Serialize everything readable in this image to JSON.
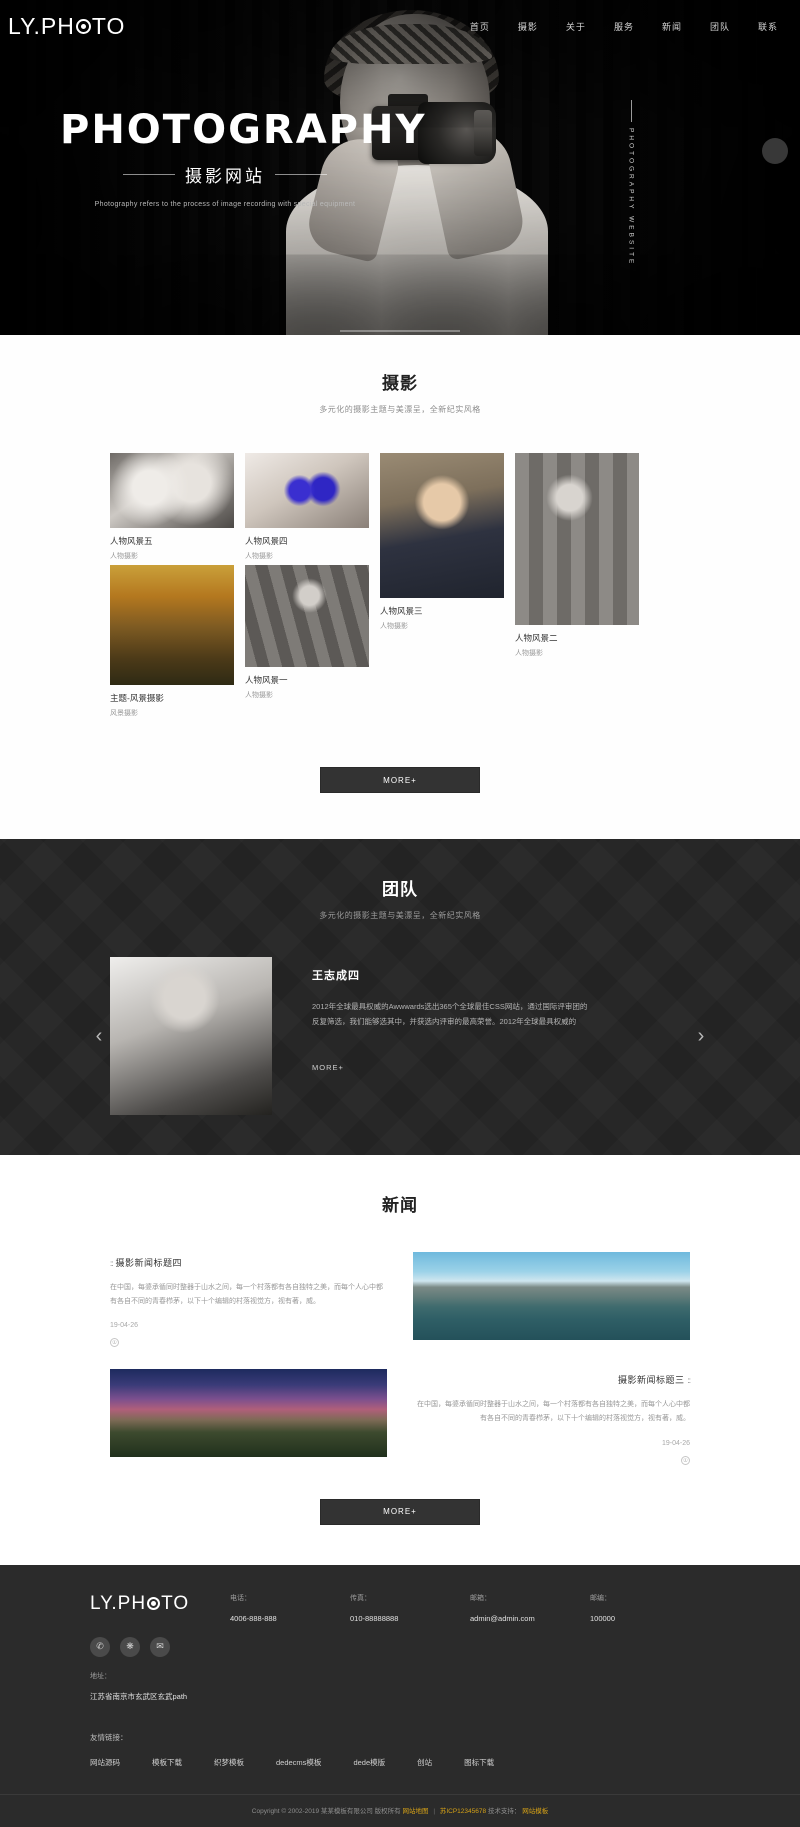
{
  "brand": {
    "name": "LY.PHOTO",
    "pre": "LY.PH",
    "post": "TO"
  },
  "nav": {
    "items": [
      {
        "label": "首页"
      },
      {
        "label": "摄影"
      },
      {
        "label": "关于"
      },
      {
        "label": "服务"
      },
      {
        "label": "新闻"
      },
      {
        "label": "团队"
      },
      {
        "label": "联系"
      }
    ]
  },
  "hero": {
    "title": "PHOTOGRAPHY",
    "subtitle": "摄影网站",
    "description": "Photography refers to the process of image recording with special equipment",
    "vertical_text": "PHOTOGRAPHY WEBSITE"
  },
  "photography": {
    "title": "摄影",
    "subtitle": "多元化的摄影主题与美漂呈，全新纪实风格",
    "more_label": "MORE+",
    "items": [
      {
        "title": "人物风景五",
        "category": "人物摄影"
      },
      {
        "title": "人物风景四",
        "category": "人物摄影"
      },
      {
        "title": "人物风景三",
        "category": "人物摄影"
      },
      {
        "title": "人物风景二",
        "category": "人物摄影"
      },
      {
        "title": "主题-风景摄影",
        "category": "风景摄影"
      },
      {
        "title": "人物风景一",
        "category": "人物摄影"
      }
    ]
  },
  "team": {
    "title": "团队",
    "subtitle": "多元化的摄影主题与美漂呈，全新纪实风格",
    "member_name": "王志成四",
    "member_desc": "2012年全球最具权威的Awwwards选出365个全球最佳CSS网站，通过国际评审团的反复筛选，我们能够选其中，并获选内评审的最高荣誉。2012年全球最具权威的",
    "more_label": "MORE+",
    "prev_icon": "‹",
    "next_icon": "›"
  },
  "news": {
    "title": "新闻",
    "more_label": "MORE+",
    "items": [
      {
        "dots": "::",
        "title": "摄影新闻标题四",
        "body": "在中国，每婆承循同时整器于山水之间，每一个村落都有各自独特之美，而每个人心中都有各自不同的青春栉茅，以下十个编辑的村落视觉方，视有著，威。",
        "date": "19-04-26",
        "circle": "①"
      },
      {
        "dots": "::",
        "title": "摄影新闻标题三",
        "body": "在中国，每婆承循同时整器于山水之间，每一个村落都有各自独特之美，而每个人心中都有各自不同的青春栉茅，以下十个编辑的村落视觉方，视有著，威。",
        "date": "19-04-26",
        "circle": "①"
      }
    ]
  },
  "footer": {
    "contacts": [
      {
        "label": "电话：",
        "value": "4006-888-888"
      },
      {
        "label": "传真：",
        "value": "010-88888888"
      },
      {
        "label": "邮箱：",
        "value": "admin@admin.com"
      },
      {
        "label": "邮编：",
        "value": "100000"
      }
    ],
    "address": {
      "label": "地址：",
      "value": "江苏省南京市玄武区玄武path"
    },
    "links": {
      "label": "友情链接：",
      "items": [
        "网站源码",
        "模板下载",
        "织梦模板",
        "dedecms模板",
        "dede模版",
        "创站",
        "图标下载"
      ]
    },
    "socials": [
      "qq-icon",
      "weibo-icon",
      "wechat-icon"
    ],
    "copyright": {
      "text": "Copyright © 2002-2019 某某模板有限公司 版权所有",
      "link1": "网站地图",
      "sep": "|",
      "icp": "苏ICP12345678",
      "tech": "技术支持：",
      "link2": "网站模板"
    }
  }
}
